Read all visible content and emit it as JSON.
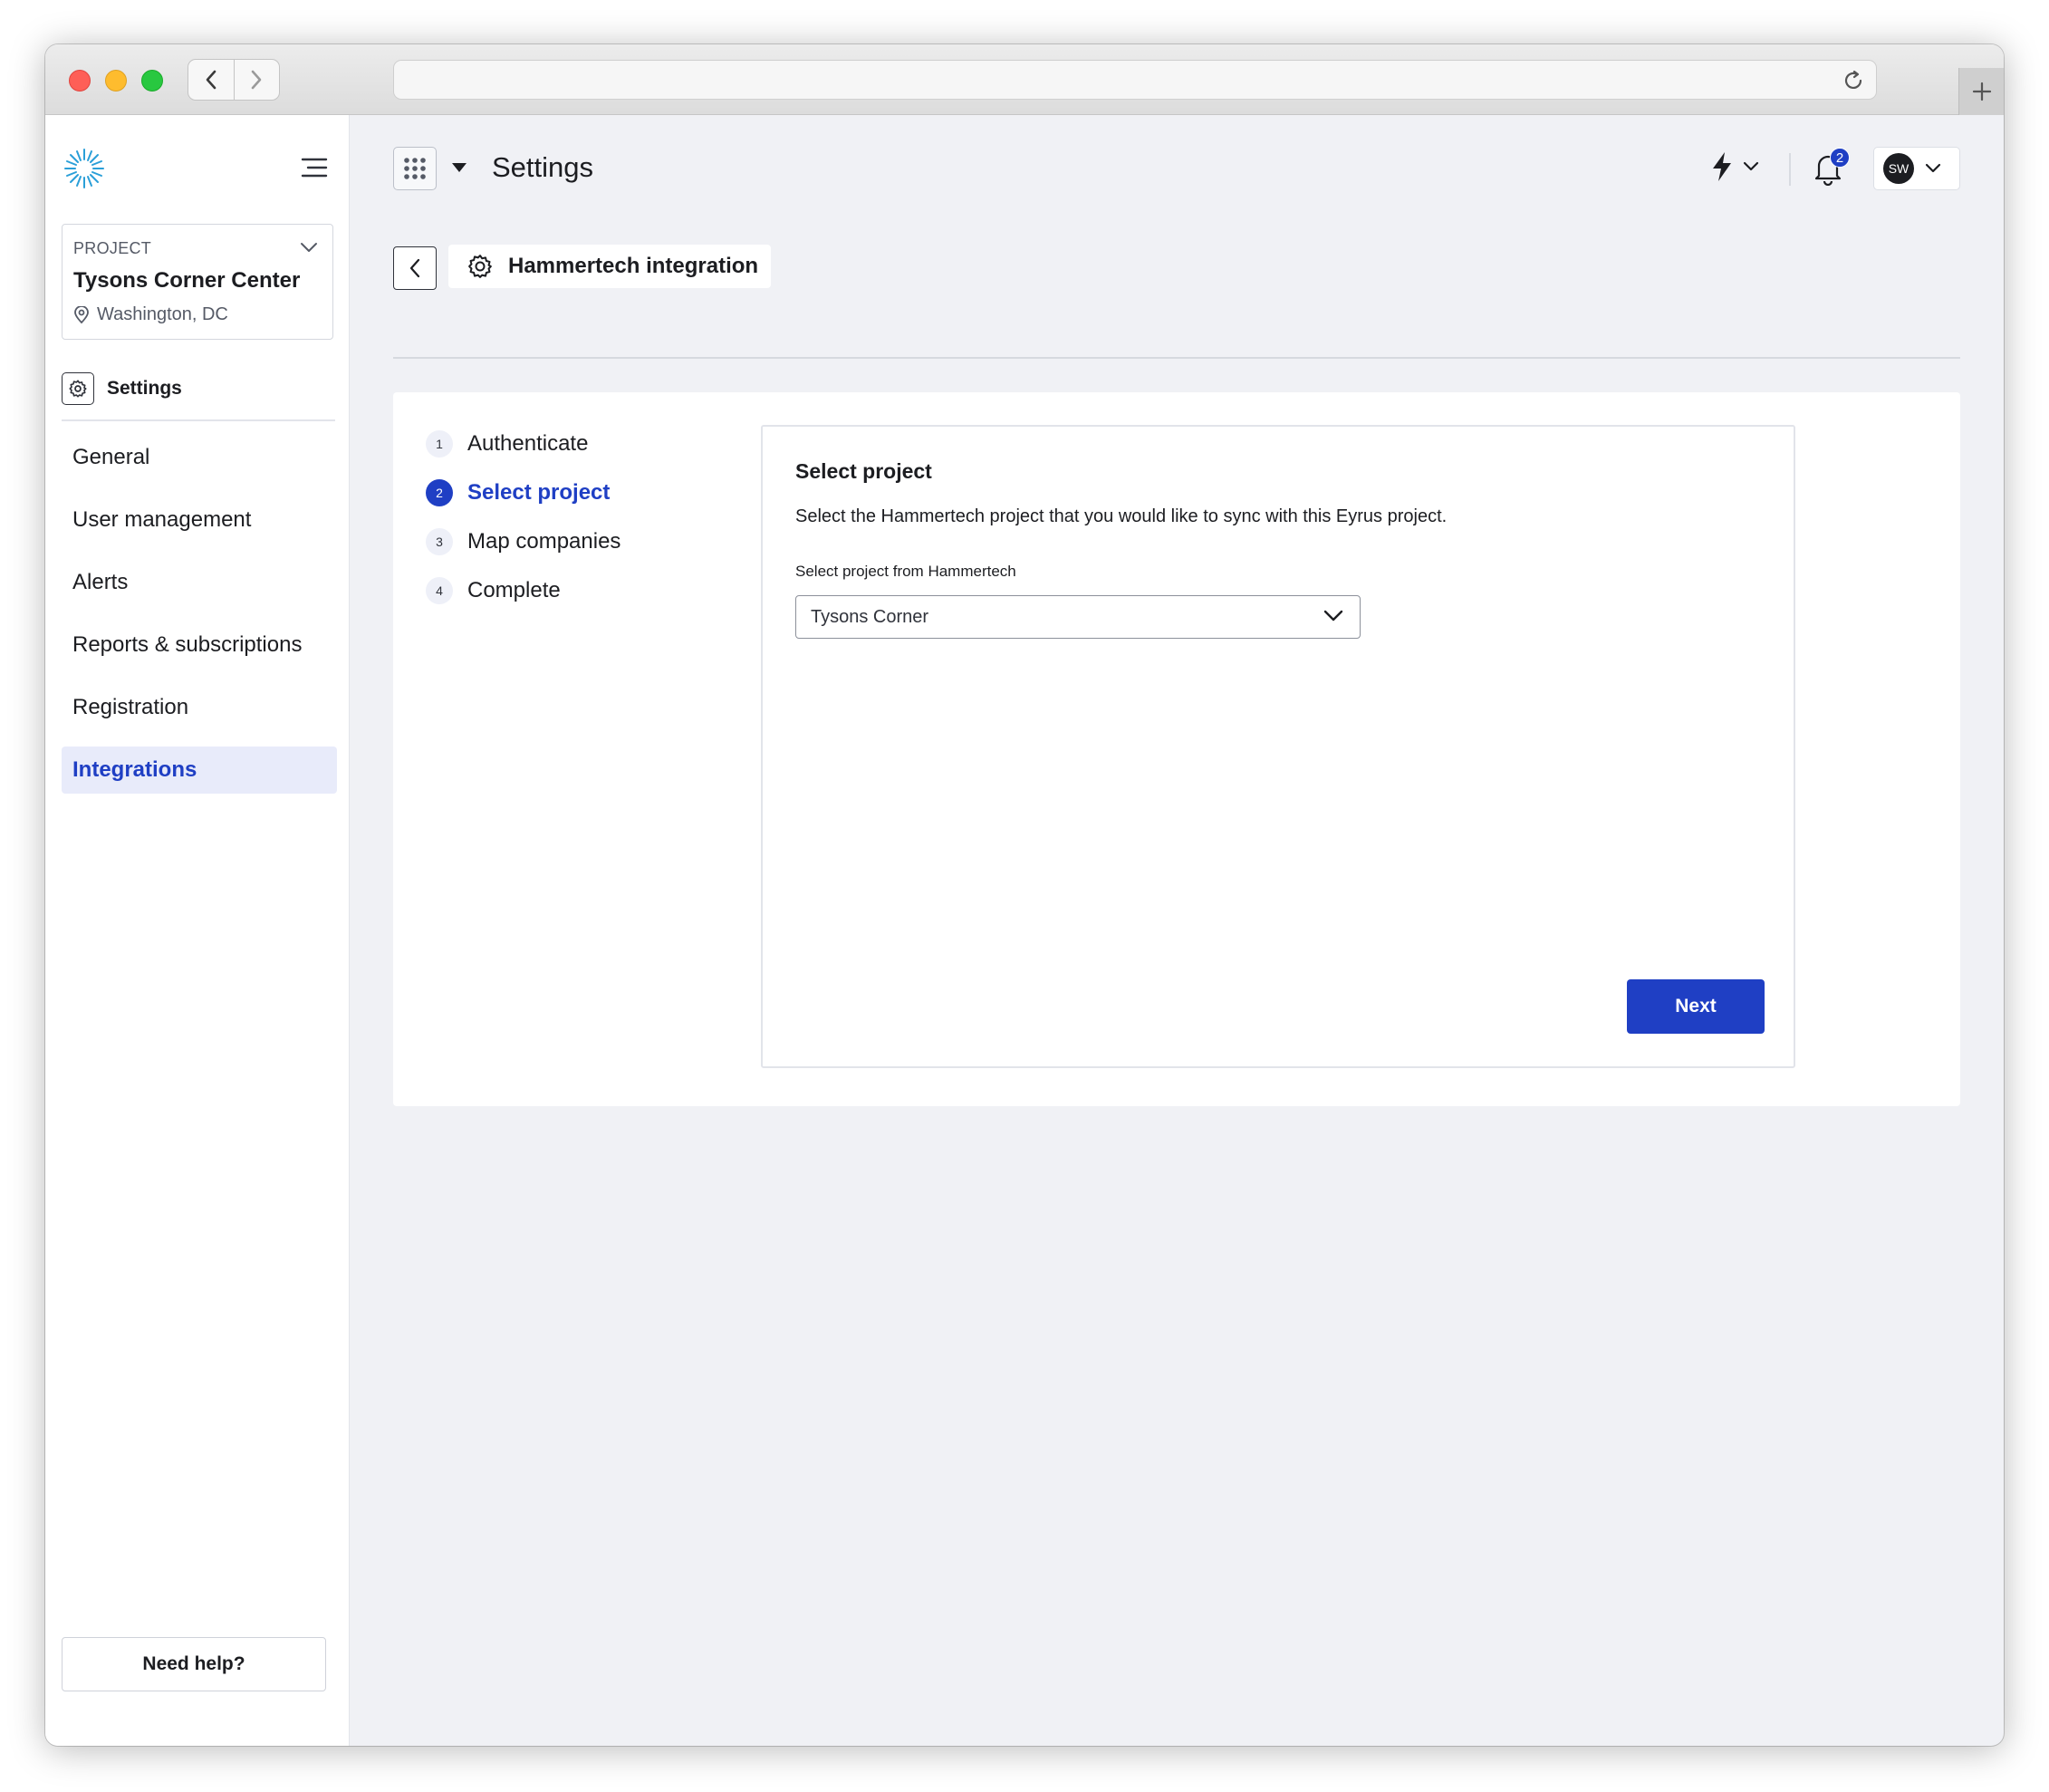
{
  "sidebar": {
    "project": {
      "label": "PROJECT",
      "name": "Tysons Corner Center",
      "location": "Washington, DC"
    },
    "section_title": "Settings",
    "items": [
      {
        "label": "General",
        "active": false
      },
      {
        "label": "User management",
        "active": false
      },
      {
        "label": "Alerts",
        "active": false
      },
      {
        "label": "Reports & subscriptions",
        "active": false
      },
      {
        "label": "Registration",
        "active": false
      },
      {
        "label": "Integrations",
        "active": true
      }
    ],
    "help_label": "Need help?"
  },
  "header": {
    "title": "Settings",
    "notification_count": "2",
    "user_initials": "SW"
  },
  "breadcrumb": {
    "label": "Hammertech integration"
  },
  "steps": [
    {
      "num": "1",
      "label": "Authenticate",
      "active": false
    },
    {
      "num": "2",
      "label": "Select project",
      "active": true
    },
    {
      "num": "3",
      "label": "Map companies",
      "active": false
    },
    {
      "num": "4",
      "label": "Complete",
      "active": false
    }
  ],
  "panel": {
    "title": "Select project",
    "description": "Select the Hammertech project that you would like to sync with this Eyrus project.",
    "field_label": "Select project from Hammertech",
    "selected_value": "Tysons Corner",
    "next_label": "Next"
  },
  "colors": {
    "accent": "#1f3fc4",
    "active_nav_bg": "#e8ebfa",
    "page_bg": "#f0f1f5"
  },
  "icons": [
    "logo-sunburst-icon",
    "hamburger-icon",
    "chevron-down-icon",
    "location-pin-icon",
    "gear-icon",
    "app-grid-icon",
    "caret-down-icon",
    "lightning-icon",
    "bell-icon",
    "chevron-left-icon",
    "reload-icon",
    "plus-icon"
  ]
}
